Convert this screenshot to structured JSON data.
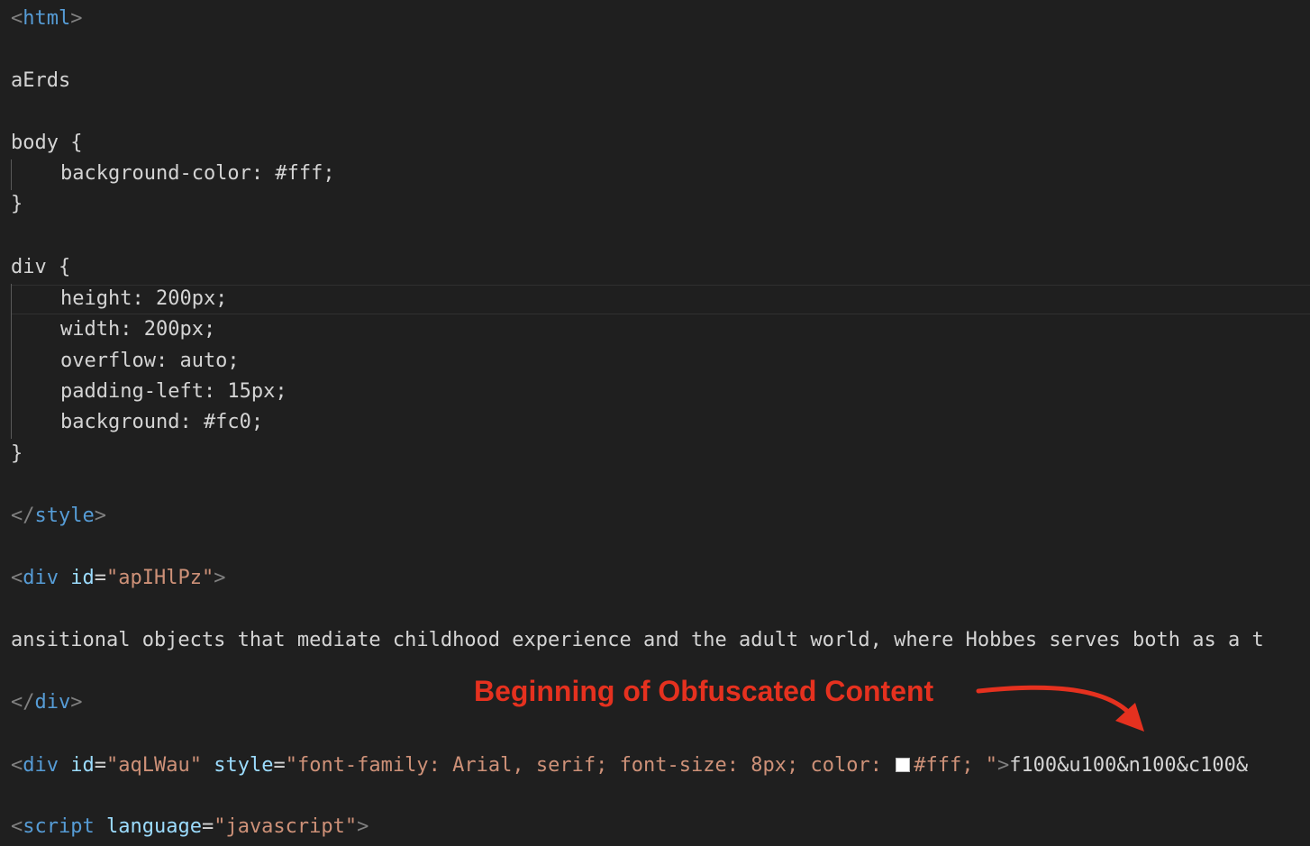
{
  "editor": {
    "colors": {
      "background": "#1f1f1f",
      "tag": "#569cd6",
      "attribute": "#9cdcfe",
      "string": "#ce9178",
      "text": "#d4d4d4",
      "punctuation": "#808080",
      "annotation": "#e5311f"
    },
    "lines": {
      "html_open": {
        "open": "<",
        "tag": "html",
        "close": ">"
      },
      "text_aErds": "aErds",
      "body_selector": "body {",
      "body_prop_background_color": "background-color: #fff;",
      "body_close": "}",
      "div_selector": "div {",
      "div_prop_height": "height: 200px;",
      "div_prop_width": "width: 200px;",
      "div_prop_overflow": "overflow: auto;",
      "div_prop_padding_left": "padding-left: 15px;",
      "div_prop_background": "background: #fc0;",
      "div_close": "}",
      "style_close": {
        "open": "</",
        "tag": "style",
        "close": ">"
      },
      "div1_open": {
        "open": "<",
        "tag": "div",
        "attr_name": "id",
        "eq": "=",
        "attr_value": "\"apIHlPz\"",
        "close": ">"
      },
      "div1_text": "ansitional objects that mediate childhood experience and the adult world, where Hobbes serves both as a t",
      "div1_close": {
        "open": "</",
        "tag": "div",
        "close": ">"
      },
      "div2_open": {
        "open": "<",
        "tag": "div",
        "attr1_name": "id",
        "eq": "=",
        "attr1_value": "\"aqLWau\"",
        "attr2_name": "style",
        "attr2_value_part1": "\"font-family: Arial, serif; font-size: 8px; color: ",
        "swatch_color": "#ffffff",
        "attr2_value_part2": "#fff; \"",
        "close": ">",
        "content": "f100&u100&n100&c100&"
      },
      "script_open": {
        "open": "<",
        "tag": "script",
        "attr_name": "language",
        "eq": "=",
        "attr_value": "\"javascript\"",
        "close": ">"
      }
    },
    "annotation": {
      "label": "Beginning of Obfuscated Content",
      "arrow_icon": "curved-arrow-icon"
    }
  }
}
